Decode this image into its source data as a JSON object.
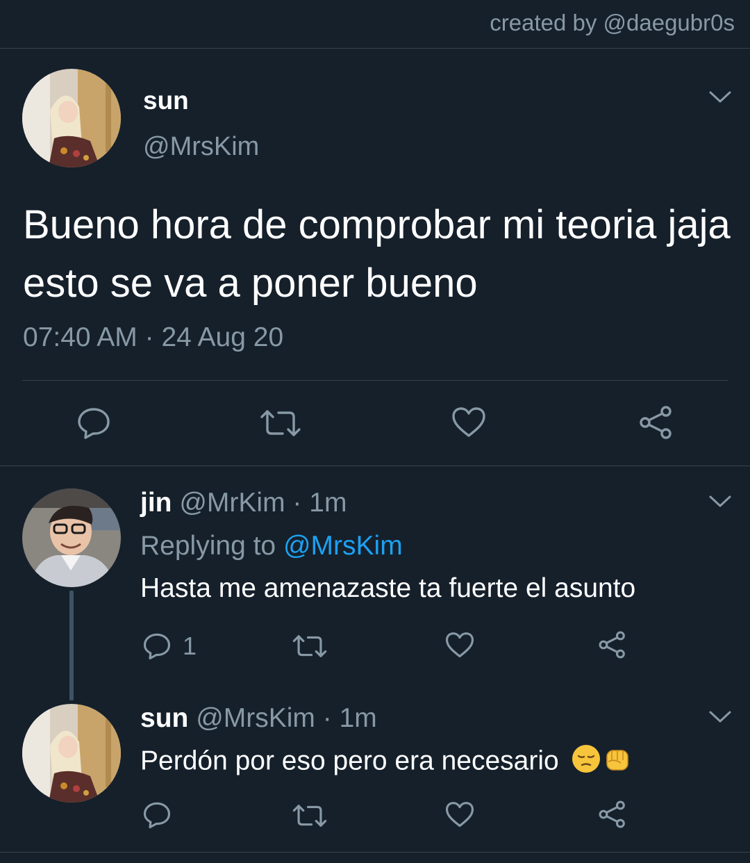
{
  "credit": "created by @daegubr0s",
  "main_tweet": {
    "name": "sun",
    "handle": "@MrsKim",
    "text": "Bueno hora de comprobar mi teoria jaja esto se va a poner bueno",
    "time": "07:40 AM",
    "separator": "·",
    "date": "24 Aug 20",
    "avatar_icon": "avatar-sun",
    "actions": [
      "reply-icon",
      "retweet-icon",
      "like-icon",
      "share-icon"
    ]
  },
  "replies": [
    {
      "name": "jin",
      "handle": "@MrKim",
      "separator": "·",
      "time": "1m",
      "replying_label": "Replying to",
      "replying_to": "@MrsKim",
      "text": "Hasta me amenazaste ta fuerte el asunto",
      "reply_count": "1",
      "avatar_icon": "avatar-jin"
    },
    {
      "name": "sun",
      "handle": "@MrsKim",
      "separator": "·",
      "time": "1m",
      "text": "Perdón por eso pero era necesario",
      "emojis": [
        "pensive-face-emoji",
        "raised-fist-emoji"
      ],
      "avatar_icon": "avatar-sun"
    }
  ],
  "colors": {
    "background": "#15202b",
    "secondary_text": "#8899a6",
    "link": "#1da1f2",
    "divider": "#38444d"
  }
}
